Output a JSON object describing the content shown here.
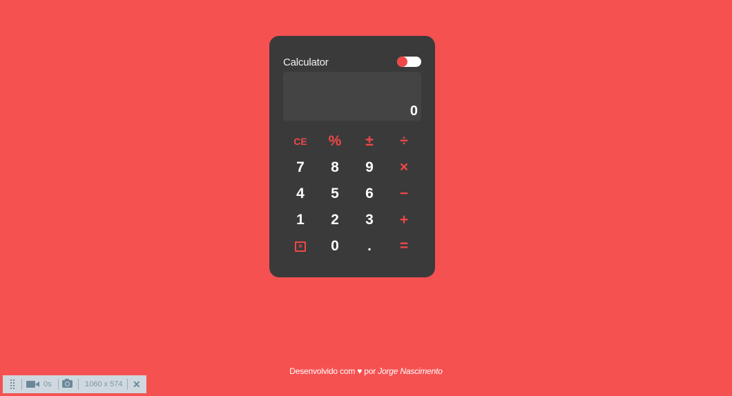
{
  "calculator": {
    "title": "Calculator",
    "history": "",
    "result": "0",
    "theme_toggle_state": "on",
    "accent_color": "#f04848",
    "keys": [
      {
        "label": "CE",
        "style": "accent small"
      },
      {
        "label": "%",
        "style": "accent"
      },
      {
        "label": "±",
        "style": "accent"
      },
      {
        "label": "÷",
        "style": "accent"
      },
      {
        "label": "7",
        "style": ""
      },
      {
        "label": "8",
        "style": ""
      },
      {
        "label": "9",
        "style": ""
      },
      {
        "label": "×",
        "style": "accent"
      },
      {
        "label": "4",
        "style": ""
      },
      {
        "label": "5",
        "style": ""
      },
      {
        "label": "6",
        "style": ""
      },
      {
        "label": "−",
        "style": "accent"
      },
      {
        "label": "1",
        "style": ""
      },
      {
        "label": "2",
        "style": ""
      },
      {
        "label": "3",
        "style": ""
      },
      {
        "label": "+",
        "style": "accent"
      },
      {
        "label": "",
        "style": "accent",
        "icon": "backspace-icon"
      },
      {
        "label": "0",
        "style": ""
      },
      {
        "label": ".",
        "style": ""
      },
      {
        "label": "=",
        "style": "accent"
      }
    ]
  },
  "footer": {
    "prefix": "Desenvolvido com ♥ por",
    "author": "Jorge Nascimento"
  },
  "devbar": {
    "timer": "0s",
    "dimensions": "1060 x 574",
    "icons": [
      "drag-handle-icon",
      "video-camera-icon",
      "camera-icon",
      "close-icon"
    ]
  },
  "colors": {
    "background": "#f65151",
    "calculator_body": "#3b3a3b",
    "display": "#444444"
  }
}
